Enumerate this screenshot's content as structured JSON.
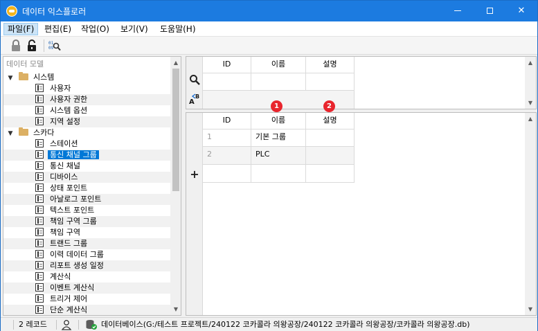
{
  "window": {
    "title": "데이터 익스플로러",
    "title_bar_color": "#1c7be0",
    "controls": {
      "minimize": "minimize-icon",
      "maximize": "maximize-icon",
      "close": "✕"
    }
  },
  "menu": [
    {
      "label": "파일(F)",
      "active": true
    },
    {
      "label": "편집(E)"
    },
    {
      "label": "작업(O)"
    },
    {
      "label": "보기(V)"
    },
    {
      "label": "도움말(H)"
    }
  ],
  "toolbar": {
    "lock_icon": "lock-icon",
    "unlock_icon": "unlock-icon",
    "query_icon": "binary-search-icon"
  },
  "tree": {
    "panel_title": "데이터 모델",
    "groups": [
      {
        "label": "시스템",
        "items": [
          "사용자",
          "사용자 권한",
          "시스템 옵션",
          "지역 설정"
        ]
      },
      {
        "label": "스카다",
        "items": [
          "스테이션",
          "통신 채널 그룹",
          "통신 채널",
          "디바이스",
          "상태 포인트",
          "아날로그 포인트",
          "텍스트 포인트",
          "책임 구역 그룹",
          "책임 구역",
          "트랜드 그룹",
          "이력 데이터 그룹",
          "리포트 생성 일정",
          "계산식",
          "이벤트 계산식",
          "트리거 제어",
          "단순 계산식"
        ],
        "selected": "통신 채널 그룹"
      }
    ]
  },
  "filter_grid": {
    "columns": [
      "ID",
      "이름",
      "설명"
    ],
    "search_icon": "search-icon",
    "sort_icon": "sort-az-icon"
  },
  "data_grid": {
    "columns": [
      "ID",
      "이름",
      "설명"
    ],
    "badges": [
      "1",
      "2"
    ],
    "rows": [
      {
        "num": "1",
        "name": "기본 그룹",
        "desc": ""
      },
      {
        "num": "2",
        "name": "PLC",
        "desc": ""
      }
    ],
    "add_icon": "+"
  },
  "status": {
    "records": "2 레코드",
    "user_icon": "user-icon",
    "db_icon": "database-icon",
    "database": "데이터베이스(G:/테스트 프로젝트/240122 코카콜라 의왕공장/240122 코카콜라 의왕공장/코카콜라 의왕공장.db)"
  }
}
